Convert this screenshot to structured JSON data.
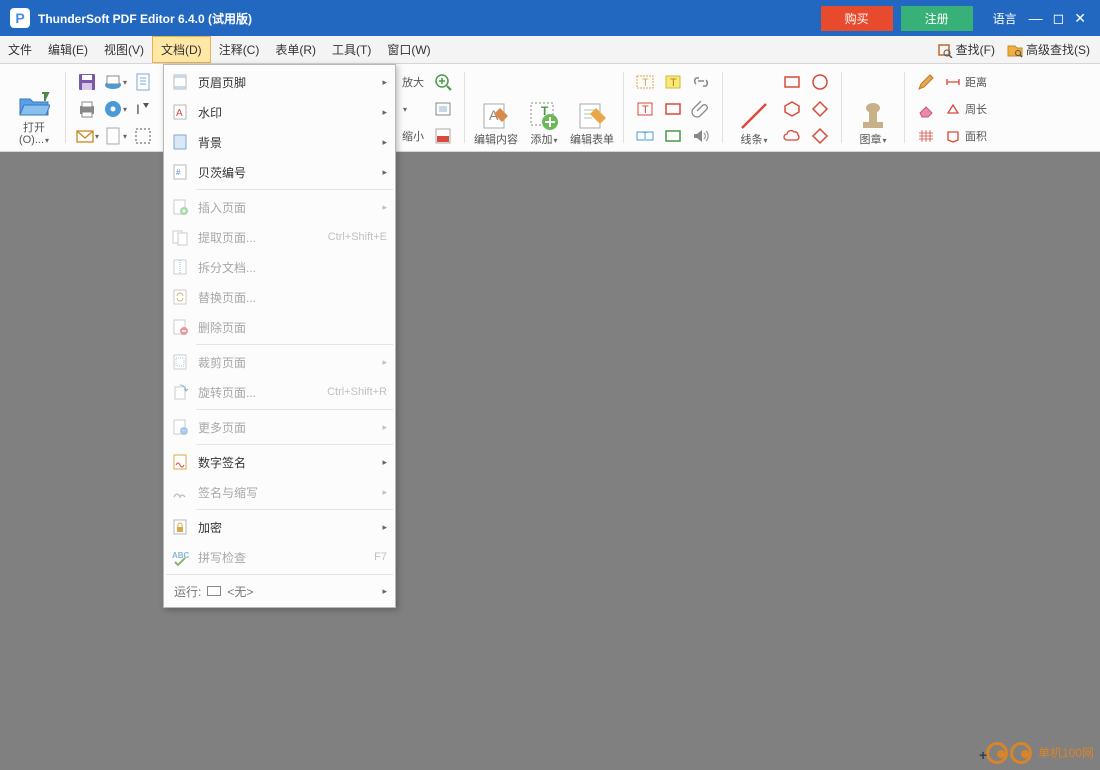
{
  "title": "ThunderSoft PDF Editor 6.4.0 (试用版)",
  "titlebar": {
    "buy": "购买",
    "register": "注册",
    "language": "语言"
  },
  "menus": {
    "file": "文件",
    "edit": "编辑(E)",
    "view": "视图(V)",
    "doc": "文档(D)",
    "comment": "注释(C)",
    "form": "表单(R)",
    "tool": "工具(T)",
    "window": "窗口(W)",
    "find": "查找(F)",
    "advFind": "高级查找(S)"
  },
  "ribbon": {
    "open": "打开(O)...",
    "zoomIn": "放大",
    "zoomOut": "缩小",
    "editContent": "编辑内容",
    "add": "添加",
    "editForm": "编辑表单",
    "lines": "线条",
    "stamp": "图章",
    "distance": "距离",
    "perimeter": "周长",
    "area": "面积"
  },
  "dropdown": {
    "headerFooter": "页眉页脚",
    "watermark": "水印",
    "background": "背景",
    "bates": "贝茨编号",
    "insertPage": "插入页面",
    "extractPage": "提取页面...",
    "splitDoc": "拆分文档...",
    "replacePage": "替换页面...",
    "deletePage": "删除页面",
    "cropPage": "裁剪页面",
    "rotatePage": "旋转页面...",
    "morePages": "更多页面",
    "digitalSign": "数字签名",
    "signInitials": "签名与缩写",
    "encrypt": "加密",
    "spellCheck": "拼写检查",
    "shortcut_extract": "Ctrl+Shift+E",
    "shortcut_rotate": "Ctrl+Shift+R",
    "shortcut_spell": "F7",
    "run": "运行:",
    "runValue": "<无>"
  },
  "watermark": {
    "line1": "单机100网"
  }
}
